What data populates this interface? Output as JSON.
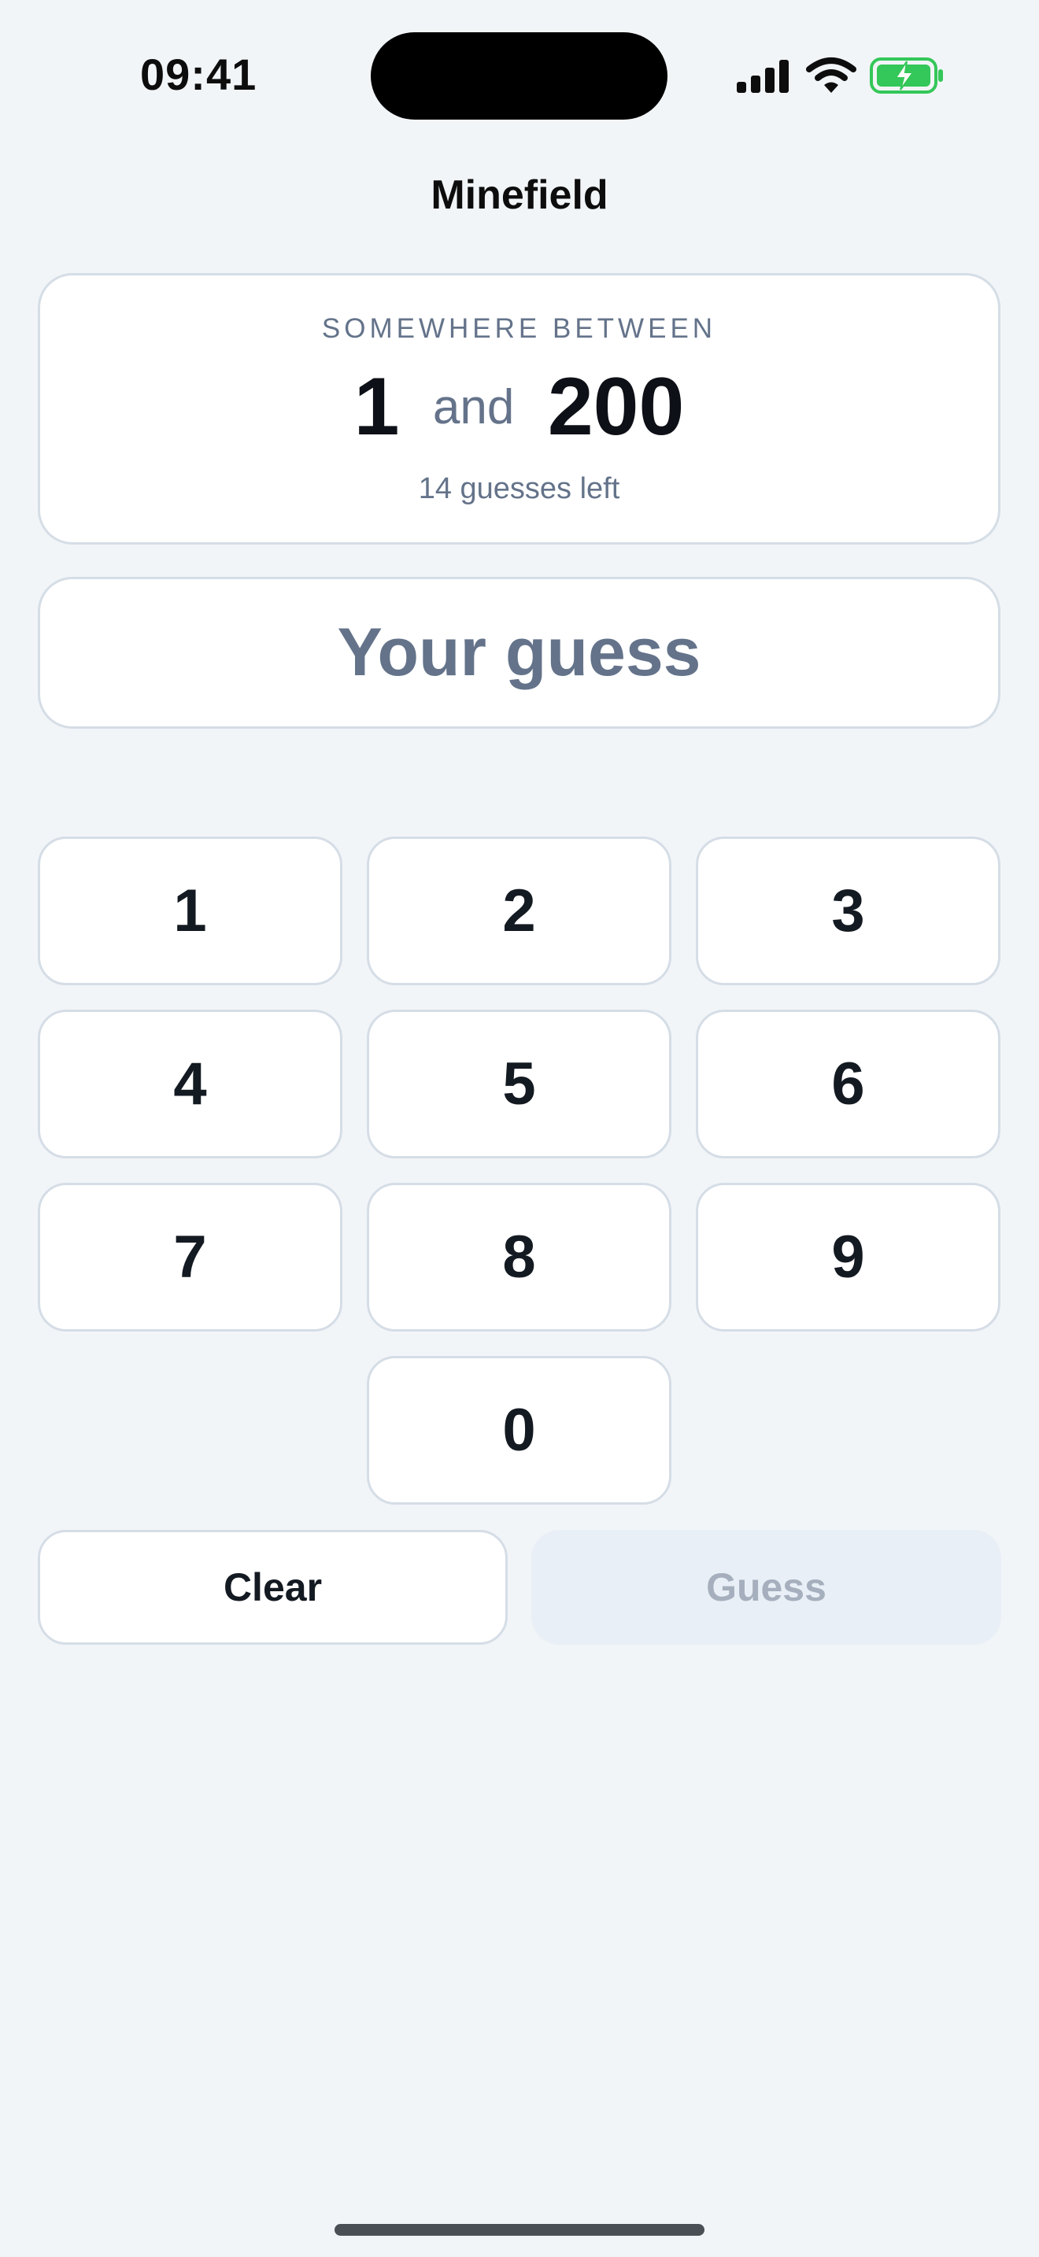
{
  "status_bar": {
    "time": "09:41",
    "icons": [
      "cellular-signal-icon",
      "wifi-icon",
      "battery-charging-icon"
    ],
    "battery_color": "#34c759"
  },
  "header": {
    "title": "Minefield"
  },
  "range_card": {
    "caption": "SOMEWHERE BETWEEN",
    "low": "1",
    "connector": "and",
    "high": "200",
    "remaining": "14 guesses left"
  },
  "guess_input": {
    "value": "",
    "placeholder": "Your guess"
  },
  "keypad": {
    "keys": [
      "1",
      "2",
      "3",
      "4",
      "5",
      "6",
      "7",
      "8",
      "9",
      "0"
    ]
  },
  "actions": {
    "clear_label": "Clear",
    "guess_label": "Guess",
    "guess_enabled": false
  },
  "colors": {
    "background": "#f2f5f8",
    "card": "#ffffff",
    "border": "#d5dde6",
    "muted_text": "#64738a",
    "disabled_button": "#e9eff6",
    "disabled_text": "#a5afbd"
  }
}
